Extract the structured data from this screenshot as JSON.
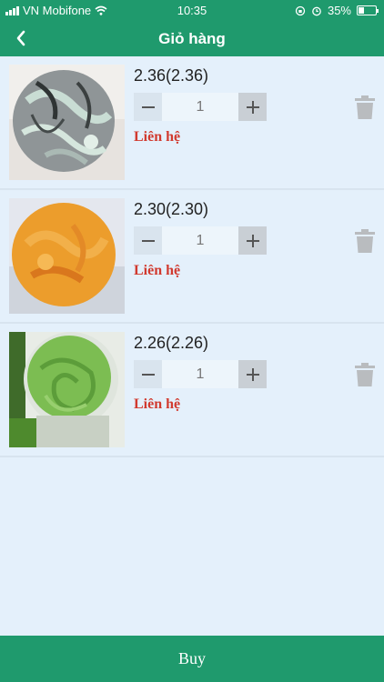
{
  "status": {
    "carrier": "VN Mobifone",
    "time": "10:35",
    "battery": "35%",
    "battery_level": 0.35
  },
  "header": {
    "title": "Giỏ hàng",
    "back_icon": "chevron-left-icon"
  },
  "cart": {
    "items": [
      {
        "price": "2.36(2.36)",
        "quantity": "1",
        "contact": "Liên hệ",
        "image": "gray-marble-soap"
      },
      {
        "price": "2.30(2.30)",
        "quantity": "1",
        "contact": "Liên hệ",
        "image": "orange-soap"
      },
      {
        "price": "2.26(2.26)",
        "quantity": "1",
        "contact": "Liên hệ",
        "image": "green-soap"
      }
    ]
  },
  "footer": {
    "buy_label": "Buy"
  },
  "colors": {
    "primary": "#1f9a6d",
    "background": "#e4f0fb",
    "contact": "#d13a2f"
  }
}
